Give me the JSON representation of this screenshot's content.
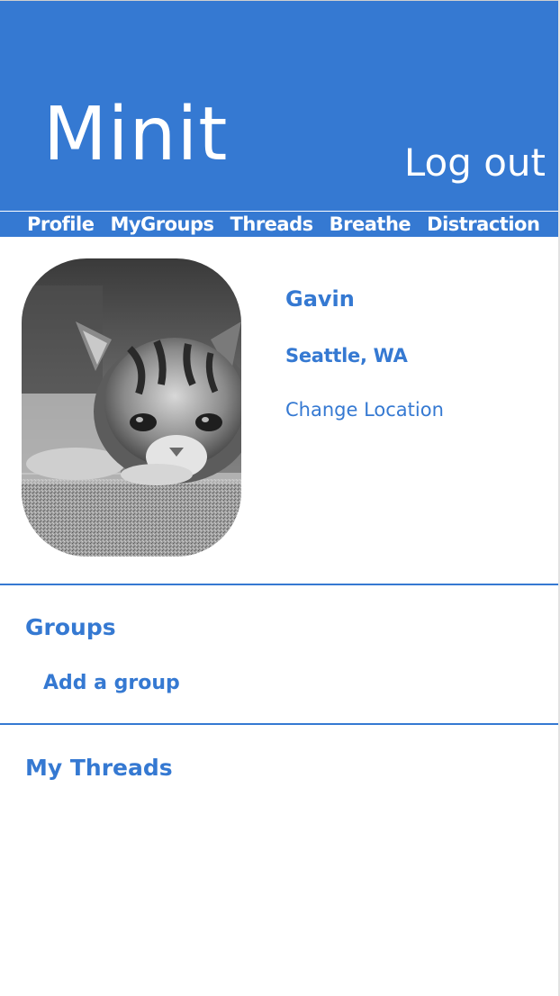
{
  "header": {
    "app_title": "Minit",
    "logout_label": "Log out"
  },
  "nav": {
    "items": [
      {
        "label": "Profile"
      },
      {
        "label": "MyGroups"
      },
      {
        "label": "Threads"
      },
      {
        "label": "Breathe"
      },
      {
        "label": "Distraction"
      }
    ]
  },
  "profile": {
    "name": "Gavin",
    "location": "Seattle, WA",
    "change_location_label": "Change Location",
    "avatar_description": "kitten-photo"
  },
  "groups": {
    "heading": "Groups",
    "add_label": "Add a group"
  },
  "threads": {
    "heading": "My Threads"
  },
  "colors": {
    "accent": "#3579d2",
    "background": "#ffffff",
    "header_text": "#ffffff"
  }
}
